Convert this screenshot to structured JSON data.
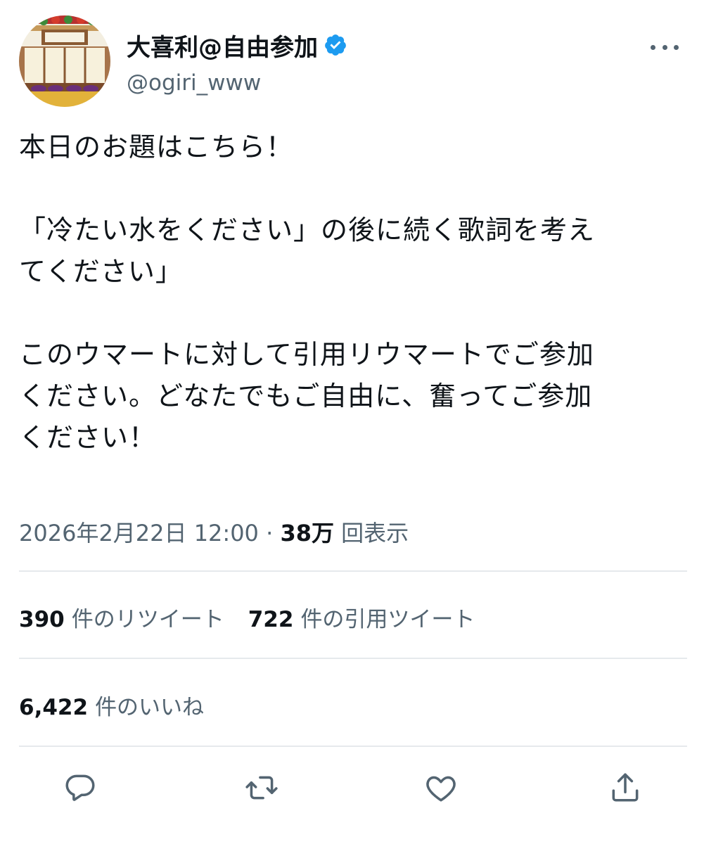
{
  "tweet": {
    "author": {
      "display_name": "大喜利@自由参加",
      "handle": "@ogiri_www",
      "verified_icon": "verified-badge-icon",
      "avatar_icon": "rakugo-stage-avatar"
    },
    "more_icon": "more-options-icon",
    "body_lines": [
      "本日のお題はこちら！",
      "「冷たい水をください」の後に続く歌詞を考え",
      "てください」",
      "このウマートに対して引用リウマートでご参加",
      "ください。どなたでもご自由に、奮ってご参加",
      "ください！"
    ],
    "timestamp": "2026年2月22日 12:00",
    "separator": "·",
    "views_count": "38万",
    "views_label": "回表示",
    "retweets_count": "390",
    "retweets_label": "件のリツイート",
    "quotes_count": "722",
    "quotes_label": "件の引用ツイート",
    "likes_count": "6,422",
    "likes_label": "件のいいね"
  },
  "colors": {
    "text_primary": "#0f1419",
    "text_secondary": "#536471",
    "verified_blue": "#1d9bf0",
    "divider": "#e6e9ec"
  },
  "actions": [
    {
      "icon": "reply-icon"
    },
    {
      "icon": "retweet-icon"
    },
    {
      "icon": "like-icon"
    },
    {
      "icon": "share-icon"
    }
  ]
}
